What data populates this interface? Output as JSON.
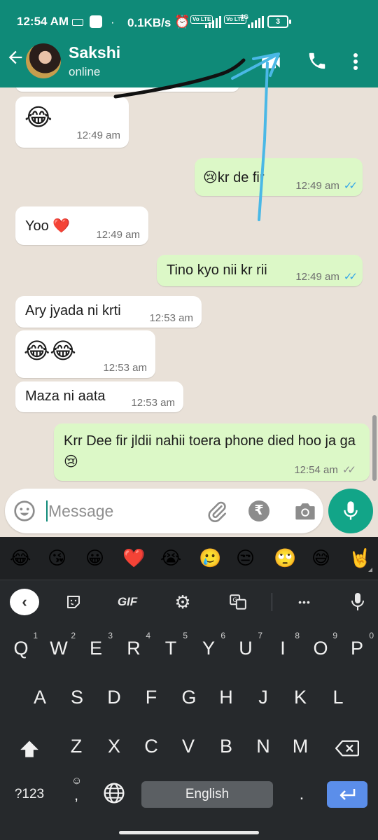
{
  "status_bar": {
    "time": "12:54 AM",
    "net_speed": "0.1KB/s",
    "sim1_label": "Vo LTE",
    "sim2_label": "Vo LTE",
    "network_type": "4G",
    "battery": "3"
  },
  "header": {
    "contact_name": "Sakshi",
    "contact_status": "online",
    "icons": [
      "back-arrow-icon",
      "video-call-icon",
      "phone-icon",
      "more-vert-icon"
    ]
  },
  "messages": [
    {
      "direction": "in",
      "text": "😂",
      "time": "12:49 am"
    },
    {
      "direction": "out",
      "text": "😢kr de fir",
      "time": "12:49 am",
      "read": true
    },
    {
      "direction": "in",
      "text": "Yoo ❤️",
      "time": "12:49 am"
    },
    {
      "direction": "out",
      "text": "Tino kyo nii kr rii",
      "time": "12:49 am",
      "read": true
    },
    {
      "direction": "in",
      "text": "Ary jyada ni krti",
      "time": "12:53 am"
    },
    {
      "direction": "in",
      "text": "😂😂",
      "time": "12:53 am"
    },
    {
      "direction": "in",
      "text": "Maza ni aata",
      "time": "12:53 am"
    },
    {
      "direction": "out",
      "text": "Krr Dee fir jldii nahii toera phone died hoo ja ga 😢",
      "time": "12:54 am",
      "read": false
    }
  ],
  "composer": {
    "placeholder": "Message",
    "rupee_symbol": "₹"
  },
  "keyboard": {
    "emoji_suggestions": [
      "😂",
      "😘",
      "😀",
      "❤️",
      "😭",
      "🥲",
      "😒",
      "🙄",
      "😅",
      "🤘"
    ],
    "toolbar": {
      "gif_label": "GIF",
      "more_label": "•••"
    },
    "row1": [
      {
        "letter": "Q",
        "num": "1"
      },
      {
        "letter": "W",
        "num": "2"
      },
      {
        "letter": "E",
        "num": "3"
      },
      {
        "letter": "R",
        "num": "4"
      },
      {
        "letter": "T",
        "num": "5"
      },
      {
        "letter": "Y",
        "num": "6"
      },
      {
        "letter": "U",
        "num": "7"
      },
      {
        "letter": "I",
        "num": "8"
      },
      {
        "letter": "O",
        "num": "9"
      },
      {
        "letter": "P",
        "num": "0"
      }
    ],
    "row2": [
      "A",
      "S",
      "D",
      "F",
      "G",
      "H",
      "J",
      "K",
      "L"
    ],
    "row3": [
      "Z",
      "X",
      "C",
      "V",
      "B",
      "N",
      "M"
    ],
    "symbols_label": "?123",
    "comma_label": ",",
    "space_label": "English",
    "period_label": "."
  },
  "colors": {
    "header": "#0f8a78",
    "outgoing_bubble": "#dcf8c7",
    "incoming_bubble": "#ffffff",
    "read_ticks": "#34a6e8",
    "mic_button": "#12a588",
    "keyboard_bg": "#26292c",
    "enter_key": "#5b8eea"
  }
}
